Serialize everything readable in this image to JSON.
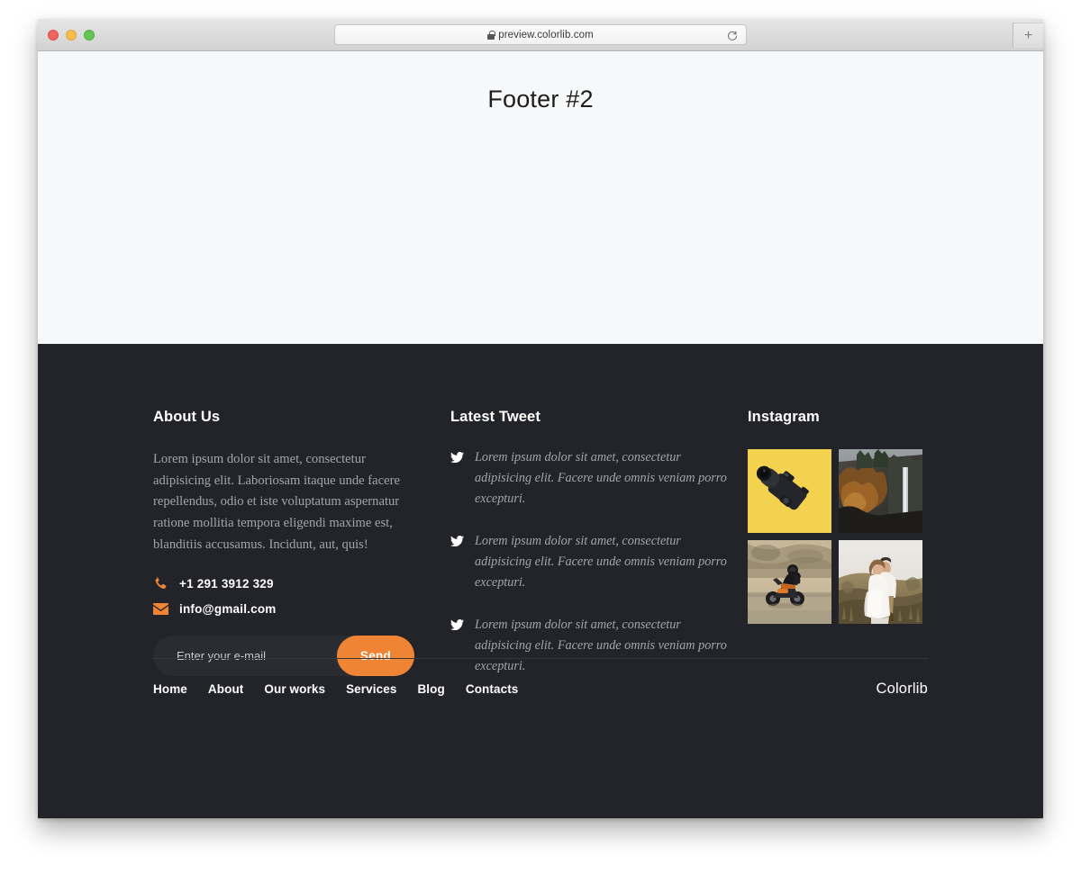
{
  "browser": {
    "url": "preview.colorlib.com",
    "lock_icon": "lock-icon",
    "reload_icon": "reload-icon",
    "new_tab_label": "+",
    "traffic_lights": [
      "close",
      "minimize",
      "zoom"
    ]
  },
  "page": {
    "title": "Footer #2"
  },
  "footer": {
    "about": {
      "title": "About Us",
      "text": "Lorem ipsum dolor sit amet, consectetur adipisicing elit. Laboriosam itaque unde facere repellendus, odio et iste voluptatum aspernatur ratione mollitia tempora eligendi maxime est, blanditiis accusamus. Incidunt, aut, quis!",
      "phone": "+1 291 3912 329",
      "email": "info@gmail.com",
      "phone_icon": "phone-icon",
      "email_icon": "envelope-icon",
      "subscribe": {
        "placeholder": "Enter your e-mail",
        "value": "",
        "button_label": "Send"
      }
    },
    "tweets": {
      "title": "Latest Tweet",
      "icon": "twitter-bird-icon",
      "items": [
        "Lorem ipsum dolor sit amet, consectetur adipisicing elit. Facere unde omnis veniam porro excepturi.",
        "Lorem ipsum dolor sit amet, consectetur adipisicing elit. Facere unde omnis veniam porro excepturi.",
        "Lorem ipsum dolor sit amet, consectetur adipisicing elit. Facere unde omnis veniam porro excepturi."
      ]
    },
    "instagram": {
      "title": "Instagram",
      "photos": [
        {
          "name": "camera-on-yellow-background"
        },
        {
          "name": "waterfall-in-autumn-forest"
        },
        {
          "name": "motorcycle-riding-on-road"
        },
        {
          "name": "couple-in-white-on-golden-field"
        }
      ]
    },
    "nav": [
      {
        "label": "Home"
      },
      {
        "label": "About"
      },
      {
        "label": "Our works"
      },
      {
        "label": "Services"
      },
      {
        "label": "Blog"
      },
      {
        "label": "Contacts"
      }
    ],
    "brand": "Colorlib"
  },
  "colors": {
    "footer_bg": "#23242a",
    "accent_orange": "#ef8534",
    "muted_text": "#a3a5ab",
    "page_bg": "#f7f8fa",
    "divider": "#35363c"
  }
}
